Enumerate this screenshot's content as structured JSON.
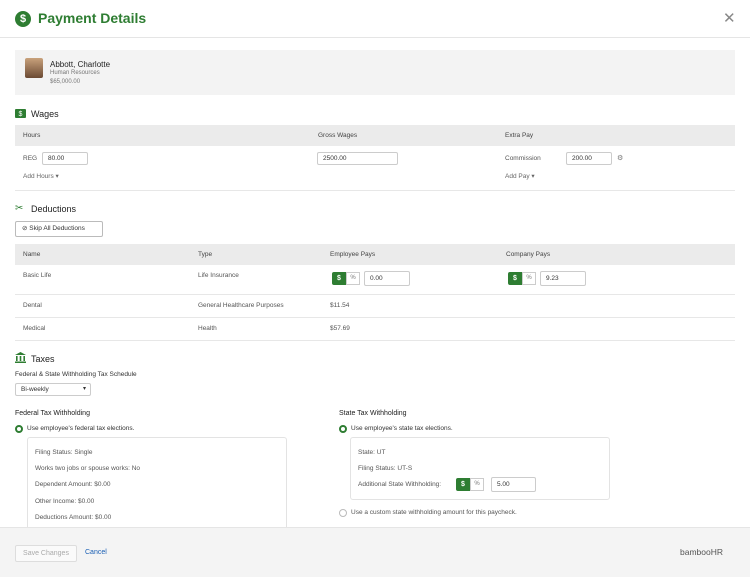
{
  "header": {
    "title": "Payment Details",
    "dollar_glyph": "$",
    "close_glyph": "✕"
  },
  "employee": {
    "name": "Abbott, Charlotte",
    "department": "Human Resources",
    "salary": "$65,000.00"
  },
  "wages": {
    "title": "Wages",
    "columns": [
      "Hours",
      "Gross Wages",
      "Extra Pay"
    ],
    "reg_label": "REG",
    "reg_value": "80.00",
    "add_hours": "Add Hours",
    "gross_value": "2500.00",
    "commission_label": "Commission",
    "commission_value": "200.00",
    "add_pay": "Add Pay"
  },
  "deductions": {
    "title": "Deductions",
    "skip_button": "Skip All Deductions",
    "columns": [
      "Name",
      "Type",
      "Employee Pays",
      "Company Pays"
    ],
    "rows": [
      {
        "name": "Basic Life",
        "type": "Life Insurance",
        "employee_value": "0.00",
        "company_value": "9.23"
      },
      {
        "name": "Dental",
        "type": "General Healthcare Purposes",
        "employee": "$11.54"
      },
      {
        "name": "Medical",
        "type": "Health",
        "employee": "$57.69"
      }
    ],
    "dollar": "$",
    "percent": "%"
  },
  "taxes": {
    "title": "Taxes",
    "schedule_label": "Federal & State Withholding Tax Schedule",
    "schedule_value": "Bi-weekly",
    "federal_title": "Federal Tax Withholding",
    "federal_option": "Use employee's federal tax elections.",
    "federal_lines": [
      "Filing Status: Single",
      "Works two jobs or spouse works: No",
      "Dependent Amount: $0.00",
      "Other Income: $0.00",
      "Deductions Amount: $0.00"
    ],
    "state_title": "State Tax Withholding",
    "state_option": "Use employee's state tax elections.",
    "state_lines": [
      "State: UT",
      "Filing Status: UT-S"
    ],
    "additional_label": "Additional State Withholding:",
    "additional_value": "5.00",
    "custom_option": "Use a custom state withholding amount for this paycheck."
  },
  "footer": {
    "save": "Save Changes",
    "cancel": "Cancel",
    "logo": "bambooHR"
  },
  "colors": {
    "brand_green": "#2e7d32",
    "link_blue": "#1a5fb4"
  }
}
